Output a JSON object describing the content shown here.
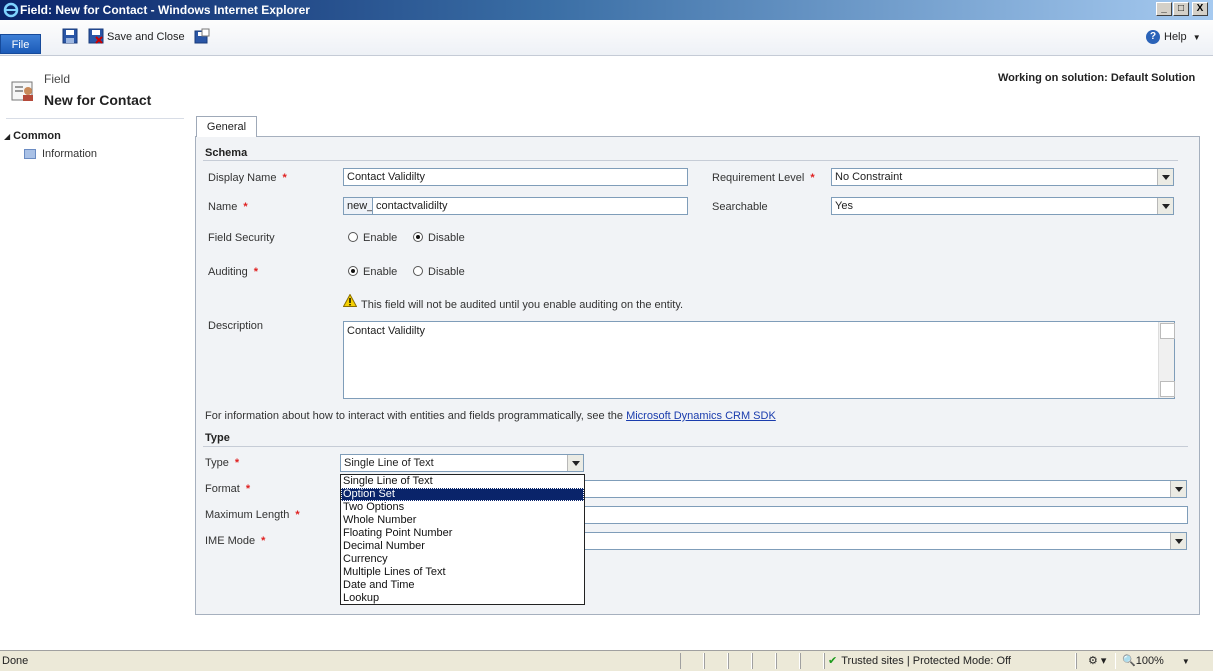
{
  "window": {
    "title": "Field: New for Contact - Windows Internet Explorer",
    "min": "_",
    "max": "□",
    "close": "X"
  },
  "ribbon": {
    "file_label": "File",
    "save_close_label": "Save and Close",
    "help_label": "Help"
  },
  "header": {
    "subtitle": "Field",
    "title": "New for Contact",
    "working_on": "Working on solution: Default Solution"
  },
  "nav": {
    "group": "Common",
    "items": [
      {
        "label": "Information"
      }
    ]
  },
  "tabs": [
    {
      "label": "General"
    }
  ],
  "schema": {
    "section_label": "Schema",
    "display_name": {
      "label": "Display Name",
      "value": "Contact Validilty"
    },
    "name": {
      "label": "Name",
      "prefix": "new_",
      "value": "contactvalidilty"
    },
    "requirement_level": {
      "label": "Requirement Level",
      "value": "No Constraint"
    },
    "searchable": {
      "label": "Searchable",
      "value": "Yes"
    },
    "field_security": {
      "label": "Field Security",
      "enable": "Enable",
      "disable": "Disable"
    },
    "auditing": {
      "label": "Auditing",
      "enable": "Enable",
      "disable": "Disable",
      "warning": "This field will not be audited until you enable auditing on the entity."
    },
    "description": {
      "label": "Description",
      "value": "Contact Validilty"
    },
    "info_text": "For information about how to interact with entities and fields programmatically, see the ",
    "info_link": "Microsoft Dynamics CRM SDK"
  },
  "type_section": {
    "section_label": "Type",
    "type": {
      "label": "Type",
      "value": "Single Line of Text"
    },
    "format": {
      "label": "Format"
    },
    "max_length": {
      "label": "Maximum Length"
    },
    "ime_mode": {
      "label": "IME Mode"
    },
    "options": [
      "Single Line of Text",
      "Option Set",
      "Two Options",
      "Whole Number",
      "Floating Point Number",
      "Decimal Number",
      "Currency",
      "Multiple Lines of Text",
      "Date and Time",
      "Lookup"
    ],
    "highlighted_option": "Option Set"
  },
  "statusbar": {
    "status": "Done",
    "zone": "Trusted sites | Protected Mode: Off",
    "zoom": "100%"
  },
  "colors": {
    "accent": "#0a246a",
    "required": "#e02020",
    "link": "#1a3cad"
  }
}
